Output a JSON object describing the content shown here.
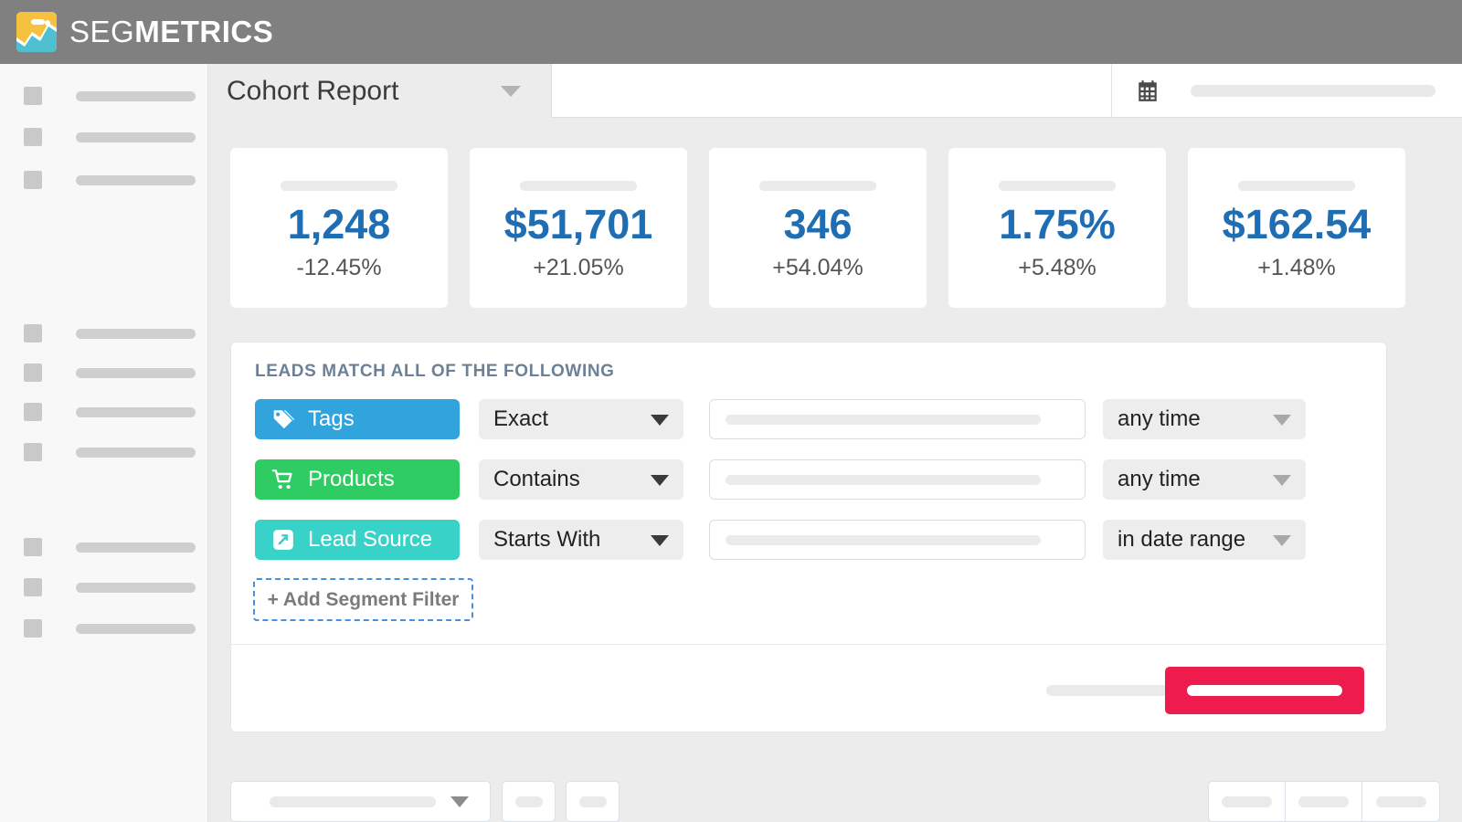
{
  "brand": {
    "name_light": "SEG",
    "name_bold": "METRICS",
    "logo_icon": "chart-logo-icon",
    "bar_color": "#808080",
    "logo_yellow": "#f5c13f",
    "logo_teal": "#4ec0d0"
  },
  "sidebar": {
    "groups": [
      {
        "items": [
          {
            "icon": "placeholder-square-icon"
          },
          {
            "icon": "placeholder-square-icon"
          },
          {
            "icon": "placeholder-square-icon"
          }
        ]
      },
      {
        "items": [
          {
            "icon": "placeholder-square-icon"
          },
          {
            "icon": "placeholder-square-icon"
          },
          {
            "icon": "placeholder-square-icon"
          },
          {
            "icon": "placeholder-square-icon"
          }
        ]
      },
      {
        "items": [
          {
            "icon": "placeholder-square-icon"
          },
          {
            "icon": "placeholder-square-icon"
          },
          {
            "icon": "placeholder-square-icon"
          }
        ]
      }
    ]
  },
  "header": {
    "report_tab_label": "Cohort Report",
    "report_tab_caret": "chevron-down-icon",
    "date_icon": "calendar-icon",
    "date_value": ""
  },
  "metrics": [
    {
      "label": "",
      "value": "1,248",
      "delta": "-12.45%"
    },
    {
      "label": "",
      "value": "$51,701",
      "delta": "+21.05%"
    },
    {
      "label": "",
      "value": "346",
      "delta": "+54.04%"
    },
    {
      "label": "",
      "value": "1.75%",
      "delta": "+5.48%"
    },
    {
      "label": "",
      "value": "$162.54",
      "delta": "+1.48%"
    }
  ],
  "filter_panel": {
    "title": "LEADS MATCH ALL OF THE FOLLOWING",
    "title_color": "#6c8197",
    "rows": [
      {
        "pill_label": "Tags",
        "pill_icon": "tag-icon",
        "pill_color": "#31a3dd",
        "operator": "Exact",
        "value": "",
        "timeframe": "any time"
      },
      {
        "pill_label": "Products",
        "pill_icon": "cart-icon",
        "pill_color": "#2ecc63",
        "operator": "Contains",
        "value": "",
        "timeframe": "any time"
      },
      {
        "pill_label": "Lead Source",
        "pill_icon": "external-link-icon",
        "pill_color": "#38d2c8",
        "operator": "Starts With",
        "value": "",
        "timeframe": "in date range"
      }
    ],
    "add_filter_label": "+ Add Segment Filter",
    "add_filter_border_color": "#4a90d9",
    "secondary_action_label": "",
    "primary_action_label": "",
    "primary_action_color": "#ee1b4d"
  },
  "bottom_toolbar": {
    "dropdown_value": "",
    "dropdown_caret": "chevron-down-icon",
    "buttons": [
      {
        "label": ""
      },
      {
        "label": ""
      }
    ],
    "segmented": [
      {
        "label": ""
      },
      {
        "label": ""
      },
      {
        "label": ""
      }
    ]
  },
  "colors": {
    "accent_blue": "#1f6eb3",
    "page_bg": "#ececec",
    "panel_bg": "#ffffff"
  }
}
